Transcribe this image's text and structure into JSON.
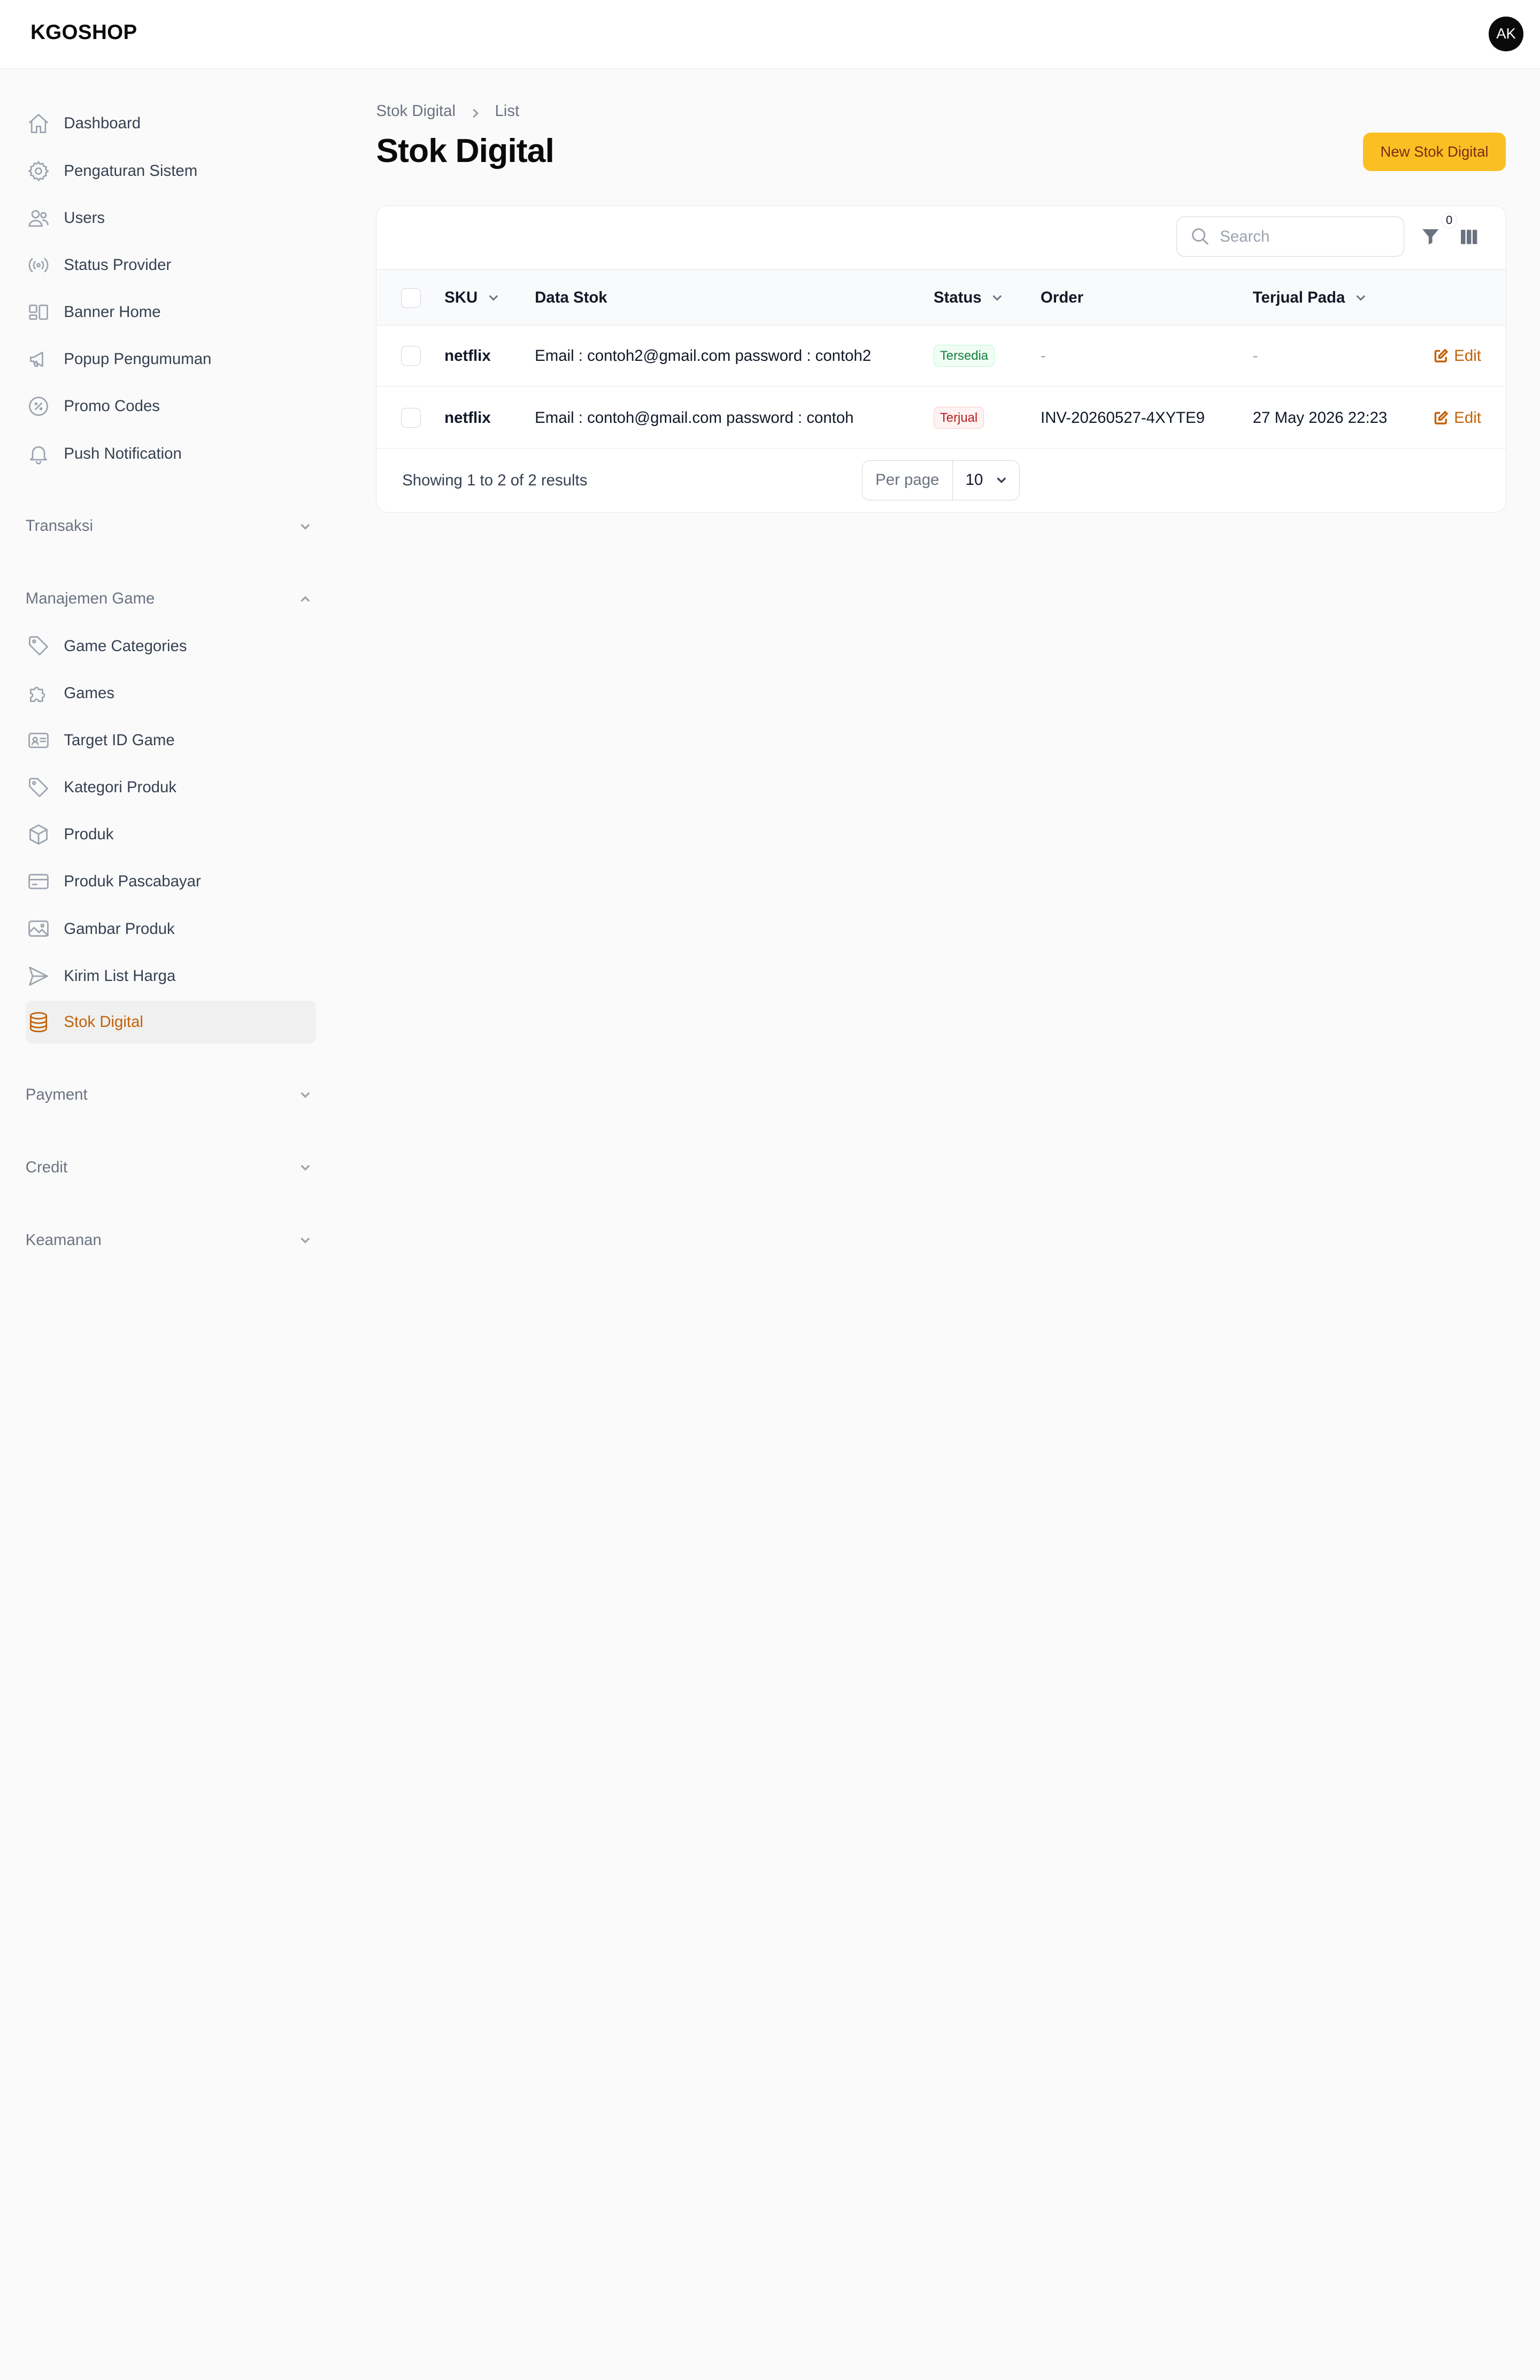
{
  "app": {
    "brand": "KGOSHOP",
    "avatar_initials": "AK"
  },
  "sidebar": {
    "items": [
      {
        "label": "Dashboard",
        "icon": "home-icon"
      },
      {
        "label": "Pengaturan Sistem",
        "icon": "gear-icon"
      },
      {
        "label": "Users",
        "icon": "users-icon"
      },
      {
        "label": "Status Provider",
        "icon": "signal-icon"
      },
      {
        "label": "Banner Home",
        "icon": "layout-icon"
      },
      {
        "label": "Popup Pengumuman",
        "icon": "megaphone-icon"
      },
      {
        "label": "Promo Codes",
        "icon": "percent-badge-icon"
      },
      {
        "label": "Push Notification",
        "icon": "bell-icon"
      }
    ],
    "groups": {
      "transaksi": {
        "label": "Transaksi",
        "expanded": false
      },
      "manajemen_game": {
        "label": "Manajemen Game",
        "expanded": true,
        "items": [
          {
            "label": "Game Categories",
            "icon": "tag-icon"
          },
          {
            "label": "Games",
            "icon": "puzzle-icon"
          },
          {
            "label": "Target ID Game",
            "icon": "id-card-icon"
          },
          {
            "label": "Kategori Produk",
            "icon": "tag-icon"
          },
          {
            "label": "Produk",
            "icon": "cube-icon"
          },
          {
            "label": "Produk Pascabayar",
            "icon": "credit-card-icon"
          },
          {
            "label": "Gambar Produk",
            "icon": "image-icon"
          },
          {
            "label": "Kirim List Harga",
            "icon": "paper-plane-icon"
          },
          {
            "label": "Stok Digital",
            "icon": "database-icon",
            "active": true
          }
        ]
      },
      "payment": {
        "label": "Payment",
        "expanded": false
      },
      "credit": {
        "label": "Credit",
        "expanded": false
      },
      "keamanan": {
        "label": "Keamanan",
        "expanded": false
      }
    }
  },
  "breadcrumb": [
    "Stok Digital",
    "List"
  ],
  "page": {
    "title": "Stok Digital",
    "new_button": "New Stok Digital"
  },
  "table": {
    "search_placeholder": "Search",
    "filter_count": "0",
    "columns": [
      "SKU",
      "Data Stok",
      "Status",
      "Order",
      "Terjual Pada"
    ],
    "rows": [
      {
        "sku": "netflix",
        "data_stok": "Email : contoh2@gmail.com password : contoh2",
        "status": "Tersedia",
        "status_color": "#15803d",
        "order": "-",
        "terjual_pada": "-",
        "action": "Edit"
      },
      {
        "sku": "netflix",
        "data_stok": "Email : contoh@gmail.com password : contoh",
        "status": "Terjual",
        "status_color": "#b91c1c",
        "order": "INV-20260527-4XYTE9",
        "terjual_pada": "27 May 2026 22:23",
        "action": "Edit"
      }
    ],
    "summary": "Showing 1 to 2 of 2 results",
    "per_page_label": "Per page",
    "per_page_value": "10"
  },
  "colors": {
    "accent": "#fbbf24",
    "accent_text": "#c2620a"
  }
}
